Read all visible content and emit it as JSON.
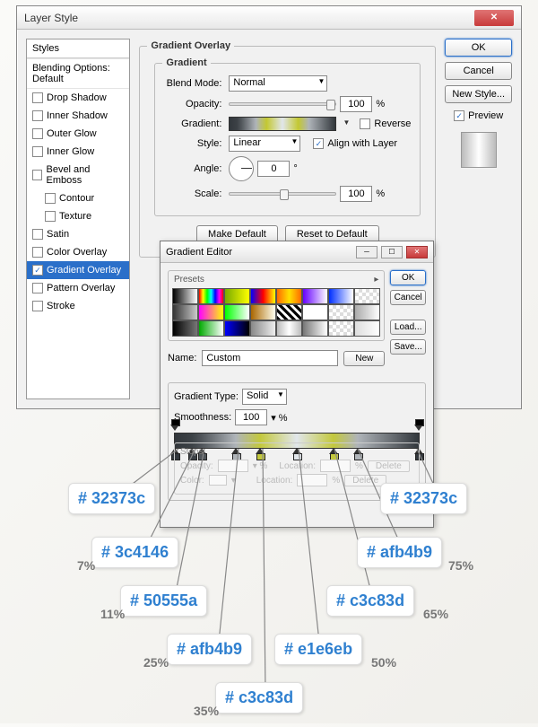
{
  "dialog": {
    "title": "Layer Style",
    "styles_header": "Styles",
    "blending_label": "Blending Options: Default",
    "items": [
      {
        "label": "Drop Shadow",
        "checked": false
      },
      {
        "label": "Inner Shadow",
        "checked": false
      },
      {
        "label": "Outer Glow",
        "checked": false
      },
      {
        "label": "Inner Glow",
        "checked": false
      },
      {
        "label": "Bevel and Emboss",
        "checked": false
      },
      {
        "label": "Contour",
        "checked": false,
        "indent": true
      },
      {
        "label": "Texture",
        "checked": false,
        "indent": true
      },
      {
        "label": "Satin",
        "checked": false
      },
      {
        "label": "Color Overlay",
        "checked": false
      },
      {
        "label": "Gradient Overlay",
        "checked": true,
        "selected": true
      },
      {
        "label": "Pattern Overlay",
        "checked": false
      },
      {
        "label": "Stroke",
        "checked": false
      }
    ]
  },
  "gradient_overlay": {
    "title": "Gradient Overlay",
    "subtitle": "Gradient",
    "blend_mode_label": "Blend Mode:",
    "blend_mode_value": "Normal",
    "opacity_label": "Opacity:",
    "opacity_value": "100",
    "gradient_label": "Gradient:",
    "reverse_label": "Reverse",
    "style_label": "Style:",
    "style_value": "Linear",
    "align_label": "Align with Layer",
    "angle_label": "Angle:",
    "angle_value": "0",
    "scale_label": "Scale:",
    "scale_value": "100",
    "make_default": "Make Default",
    "reset_default": "Reset to Default"
  },
  "right": {
    "ok": "OK",
    "cancel": "Cancel",
    "new_style": "New Style...",
    "preview": "Preview"
  },
  "editor": {
    "title": "Gradient Editor",
    "presets_label": "Presets",
    "ok": "OK",
    "cancel": "Cancel",
    "load": "Load...",
    "save": "Save...",
    "new": "New",
    "name_label": "Name:",
    "name_value": "Custom",
    "gradient_type_label": "Gradient Type:",
    "gradient_type_value": "Solid",
    "smoothness_label": "Smoothness:",
    "smoothness_value": "100",
    "stops_label": "Stops",
    "opacity_label": "Opacity:",
    "location_label": "Location:",
    "color_label": "Color:",
    "delete_label": "Delete"
  },
  "gradient_stops": [
    {
      "color": "#32373c",
      "location": "0%"
    },
    {
      "color": "#3c4146",
      "location": "7%"
    },
    {
      "color": "#50555a",
      "location": "11%"
    },
    {
      "color": "#afb4b9",
      "location": "25%"
    },
    {
      "color": "#c3c83d",
      "location": "35%"
    },
    {
      "color": "#e1e6eb",
      "location": "50%"
    },
    {
      "color": "#c3c83d",
      "location": "65%"
    },
    {
      "color": "#afb4b9",
      "location": "75%"
    },
    {
      "color": "#32373c",
      "location": "100%"
    }
  ],
  "callouts": [
    {
      "text": "# 32373c",
      "pct": ""
    },
    {
      "text": "# 3c4146",
      "pct": "7%"
    },
    {
      "text": "# 50555a",
      "pct": "11%"
    },
    {
      "text": "# afb4b9",
      "pct": "25%"
    },
    {
      "text": "# c3c83d",
      "pct": "35%"
    },
    {
      "text": "# e1e6eb",
      "pct": "50%"
    },
    {
      "text": "# c3c83d",
      "pct": "65%"
    },
    {
      "text": "# afb4b9",
      "pct": "75%"
    },
    {
      "text": "# 32373c",
      "pct": ""
    }
  ]
}
